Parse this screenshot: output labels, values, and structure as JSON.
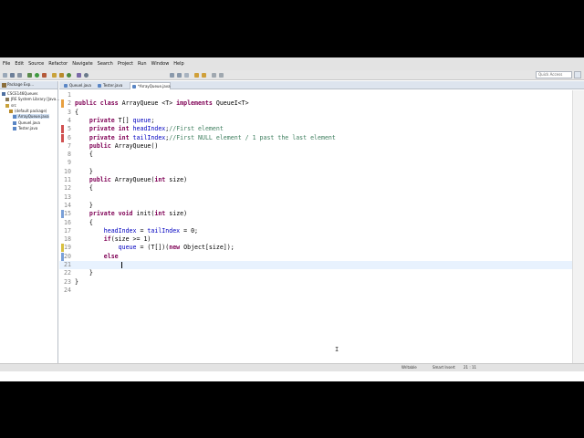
{
  "menu": [
    "File",
    "Edit",
    "Source",
    "Refactor",
    "Navigate",
    "Search",
    "Project",
    "Run",
    "Window",
    "Help"
  ],
  "toolbar": {
    "quick_access_placeholder": "Quick Access"
  },
  "package_explorer": {
    "title": "Package Exp...",
    "tree": [
      {
        "label": "CSCE146Queues",
        "indent": 0
      },
      {
        "label": "JRE System Library [Java...",
        "indent": 1
      },
      {
        "label": "src",
        "indent": 1
      },
      {
        "label": "(default package)",
        "indent": 2
      },
      {
        "label": "ArrayQueue.java",
        "indent": 3,
        "selected": true
      },
      {
        "label": "QueueI.java",
        "indent": 3
      },
      {
        "label": "Tester.java",
        "indent": 3
      }
    ]
  },
  "editor_tabs": [
    {
      "label": "QueueI.java",
      "active": false
    },
    {
      "label": "Tester.java",
      "active": false
    },
    {
      "label": "*ArrayQueue.java",
      "active": true
    }
  ],
  "code_lines": [
    {
      "n": "1",
      "html": ""
    },
    {
      "n": "2",
      "html": "<span class=\"kw\">public class</span> ArrayQueue &lt;T&gt; <span class=\"kw\">implements</span> QueueI&lt;T&gt;"
    },
    {
      "n": "3",
      "html": "{"
    },
    {
      "n": "4",
      "html": "    <span class=\"kw\">private</span> T[] <span class=\"fld\">queue</span>;"
    },
    {
      "n": "5",
      "html": "    <span class=\"kw\">private int</span> <span class=\"fld\">headIndex</span>;<span class=\"cm\">//First element</span>"
    },
    {
      "n": "6",
      "html": "    <span class=\"kw\">private int</span> <span class=\"fld\">tailIndex</span>;<span class=\"cm\">//First NULL element / 1 past the last element</span>"
    },
    {
      "n": "7",
      "html": "    <span class=\"kw\">public</span> ArrayQueue()"
    },
    {
      "n": "8",
      "html": "    {"
    },
    {
      "n": "9",
      "html": ""
    },
    {
      "n": "10",
      "html": "    }"
    },
    {
      "n": "11",
      "html": "    <span class=\"kw\">public</span> ArrayQueue(<span class=\"kw\">int</span> size)"
    },
    {
      "n": "12",
      "html": "    {"
    },
    {
      "n": "13",
      "html": ""
    },
    {
      "n": "14",
      "html": "    }"
    },
    {
      "n": "15",
      "html": "    <span class=\"kw\">private void</span> init(<span class=\"kw\">int</span> size)"
    },
    {
      "n": "16",
      "html": "    {"
    },
    {
      "n": "17",
      "html": "        <span class=\"fld\">headIndex</span> = <span class=\"fld\">tailIndex</span> = 0;"
    },
    {
      "n": "18",
      "html": "        <span class=\"kw\">if</span>(size &gt;= 1)"
    },
    {
      "n": "19",
      "html": "            <span class=\"fld\">queue</span> = (T[])(<span class=\"kw\">new</span> Object[size]);"
    },
    {
      "n": "20",
      "html": "        <span class=\"kw\">else</span>"
    },
    {
      "n": "21",
      "html": "        "
    },
    {
      "n": "22",
      "html": "    }"
    },
    {
      "n": "23",
      "html": "}"
    },
    {
      "n": "24",
      "html": ""
    }
  ],
  "current_line": "21",
  "status": {
    "writable": "Writable",
    "insert_mode": "Smart Insert",
    "position": "21 : 11"
  },
  "colors": {
    "keyword": "#7f0055",
    "field": "#0000c0",
    "comment": "#3f7f5f",
    "current_line": "#e8f2fe"
  }
}
